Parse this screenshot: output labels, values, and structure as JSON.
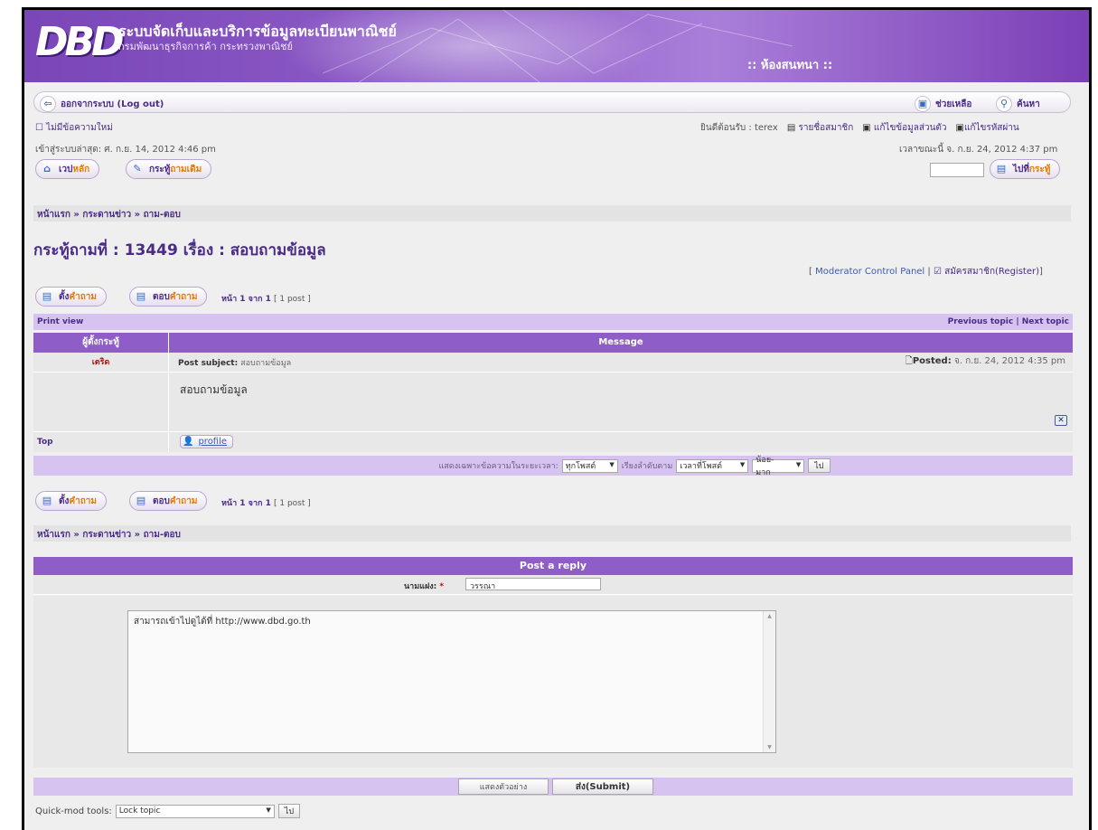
{
  "banner": {
    "logo_text": "DBD",
    "line1": "ระบบจัดเก็บและบริการข้อมูลทะเบียนพาณิชย์",
    "line2": "กรมพัฒนาธุรกิจการค้า กระทรวงพาณิชย์",
    "title": ":: ห้องสนทนา ::"
  },
  "topbar": {
    "logout_label": "ออกจากระบบ (Log out)",
    "help_label": "ช่วยเหลือ",
    "search_label": "ค้นหา"
  },
  "user": {
    "no_new_messages": "ไม่มีข้อความใหม่",
    "welcome": "ยินดีต้อนรับ  : terex",
    "members_list": "รายชื่อสมาชิก",
    "edit_profile": "แก้ไขข้อมูลส่วนตัว",
    "change_password": "แก้ไขรหัสผ่าน",
    "last_visit": "เข้าสู่ระบบล่าสุด: ศ. ก.ย. 14, 2012 4:46 pm",
    "current_time": "เวลาขณะนี้  จ. ก.ย. 24, 2012 4:37 pm"
  },
  "nav": {
    "home_a": "เวป",
    "home_b": "หลัก",
    "all_topics_a": "กระทู้",
    "all_topics_b": "ถามเดิม",
    "goto_a": "ไปที่",
    "goto_b": "กระทู้",
    "goto_value": ""
  },
  "breadcrumb": "หน้าแรก » กระดานข่าว » ถาม-ตอบ",
  "topic_title": "กระทู้ถามที่ : 13449 เรื่อง : สอบถามข้อมูล",
  "mod_links": {
    "open": "[ ",
    "moderator": "Moderator Control Panel",
    "sep": " | ",
    "register": "สมัครสมาชิก(Register)",
    "close": "]"
  },
  "actions": {
    "new_topic_a": "ตั้ง",
    "new_topic_b": "คำถาม",
    "reply_a": "ตอบ",
    "reply_b": "คำถาม",
    "page_info": "หน้า 1 จาก 1",
    "post_count": "[ 1 post ]"
  },
  "post_table": {
    "print_view": "Print view",
    "prev_topic": "Previous topic",
    "next_sep": " | ",
    "next_topic": "Next topic",
    "col_author": "ผู้ตั้งกระทู้",
    "col_message": "Message",
    "author": "เตริด",
    "subject_label": "Post subject:",
    "subject": "สอบถามข้อมูล",
    "posted_label": "Posted:",
    "posted_date": "จ. ก.ย. 24, 2012 4:35 pm",
    "body": "สอบถามข้อมูล",
    "top_link": "Top",
    "profile_label": "profile"
  },
  "filter": {
    "label": "แสดงเฉพาะข้อความในระยะเวลา:",
    "period": "ทุกโพสต์",
    "sort_label": "เรียงลำดับตาม",
    "sort_by": "เวลาที่โพสต์",
    "order": "น้อย-มาก",
    "go": "ไป"
  },
  "reply": {
    "header": "Post a reply",
    "name_label": "นามแฝง:",
    "required": "*",
    "name_value": "วรรณา",
    "message": "สามารถเข้าไปดูได้ที่  http://www.dbd.go.th",
    "preview": "แสดงตัวอย่าง",
    "submit": "ส่ง(Submit)"
  },
  "quickmod": {
    "label": "Quick-mod tools:",
    "value": "Lock topic",
    "go": "ไป"
  }
}
